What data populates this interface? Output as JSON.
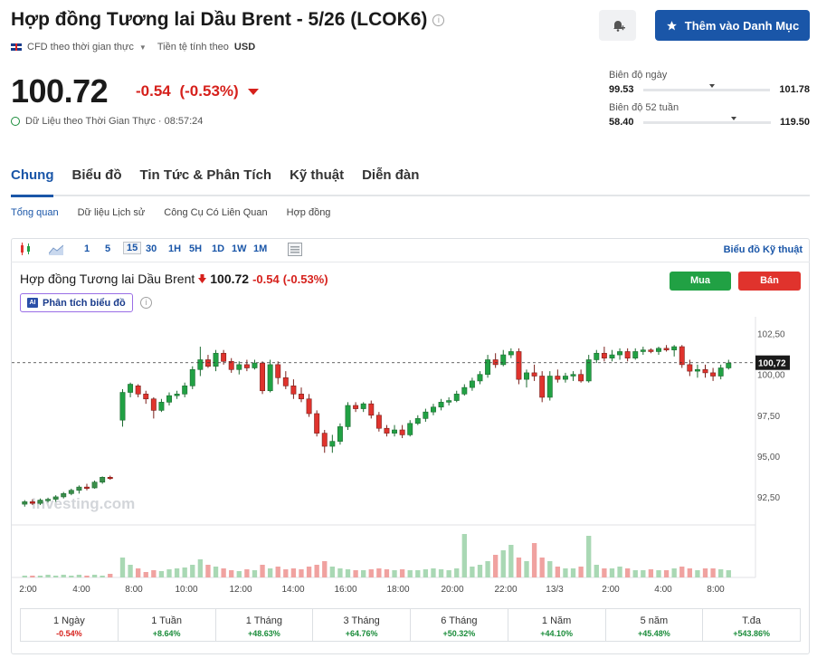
{
  "header": {
    "title": "Hợp đồng Tương lai Dầu Brent - 5/26 (LCOK6)",
    "info_glyph": "i",
    "watch_label": "Thêm vào Danh Mục",
    "cfd_label": "CFD theo thời gian thực",
    "currency_label": "Tiền tệ tính theo",
    "currency": "USD"
  },
  "quote": {
    "price": "100.72",
    "change": "-0.54",
    "change_pct": "(-0.53%)",
    "realtime_label": "Dữ Liệu theo Thời Gian Thực · 08:57:24"
  },
  "ranges": {
    "day": {
      "label": "Biên độ ngày",
      "low": "99.53",
      "high": "101.78",
      "position": 0.52
    },
    "week52": {
      "label": "Biên độ 52 tuần",
      "low": "58.40",
      "high": "119.50",
      "position": 0.69
    }
  },
  "main_tabs": [
    "Chung",
    "Biểu đồ",
    "Tin Tức & Phân Tích",
    "Kỹ thuật",
    "Diễn đàn"
  ],
  "sub_tabs": [
    "Tổng quan",
    "Dữ liệu Lịch sử",
    "Công Cụ Có Liên Quan",
    "Hợp đồng"
  ],
  "toolbar": {
    "intervals": [
      "1",
      "5",
      "15",
      "30",
      "1H",
      "5H",
      "1D",
      "1W",
      "1M"
    ],
    "selected_interval": "15",
    "advanced_label": "Biểu đồ Kỹ thuật"
  },
  "chart_header": {
    "name": "Hợp đồng Tương lai Dầu Brent",
    "price": "100.72",
    "change": "-0.54",
    "change_pct": "(-0.53%)",
    "buy_label": "Mua",
    "sell_label": "Bán",
    "ai_label": "Phân tích biểu đồ",
    "ai_badge": "AI",
    "watermark": "Investing.com"
  },
  "colors": {
    "up": "#21a144",
    "down": "#e0332d",
    "accent": "#1a56a8"
  },
  "chart_data": {
    "type": "candlestick",
    "y_ticks": [
      "102,50",
      "100,00",
      "97,50",
      "95,00",
      "92,50"
    ],
    "ylim": [
      91.0,
      103.2
    ],
    "current_label": "100,72",
    "current_value": 100.72,
    "x_ticks": [
      "2:00",
      "4:00",
      "8:00",
      "10:00",
      "12:00",
      "14:00",
      "16:00",
      "18:00",
      "20:00",
      "22:00",
      "13/3",
      "2:00",
      "4:00",
      "8:00"
    ],
    "candles": [
      [
        92.05,
        92.3,
        91.9,
        92.2
      ],
      [
        92.2,
        92.35,
        92.0,
        92.1
      ],
      [
        92.1,
        92.4,
        92.0,
        92.3
      ],
      [
        92.3,
        92.45,
        92.15,
        92.35
      ],
      [
        92.35,
        92.6,
        92.2,
        92.5
      ],
      [
        92.5,
        92.8,
        92.4,
        92.7
      ],
      [
        92.7,
        93.0,
        92.6,
        92.9
      ],
      [
        92.9,
        93.2,
        92.7,
        93.1
      ],
      [
        93.1,
        93.3,
        92.9,
        93.05
      ],
      [
        93.05,
        93.5,
        93.0,
        93.4
      ],
      [
        93.4,
        93.75,
        93.3,
        93.7
      ],
      [
        93.7,
        93.8,
        93.55,
        93.65
      ],
      [
        97.2,
        99.1,
        96.8,
        98.9
      ],
      [
        98.9,
        99.5,
        98.6,
        99.4
      ],
      [
        99.3,
        99.4,
        98.6,
        98.8
      ],
      [
        98.8,
        99.0,
        98.2,
        98.5
      ],
      [
        98.5,
        98.6,
        97.3,
        97.8
      ],
      [
        97.8,
        98.5,
        97.7,
        98.3
      ],
      [
        98.3,
        98.9,
        98.1,
        98.7
      ],
      [
        98.7,
        99.0,
        98.5,
        98.8
      ],
      [
        98.8,
        99.5,
        98.6,
        99.3
      ],
      [
        99.3,
        100.5,
        99.1,
        100.3
      ],
      [
        100.3,
        101.7,
        99.9,
        100.9
      ],
      [
        100.9,
        101.2,
        100.4,
        100.5
      ],
      [
        100.5,
        101.5,
        100.2,
        101.3
      ],
      [
        101.3,
        101.5,
        100.6,
        100.8
      ],
      [
        100.8,
        101.0,
        100.1,
        100.3
      ],
      [
        100.3,
        100.8,
        100.0,
        100.6
      ],
      [
        100.6,
        100.9,
        100.2,
        100.4
      ],
      [
        100.4,
        100.9,
        100.3,
        100.7
      ],
      [
        100.7,
        100.8,
        98.8,
        99.0
      ],
      [
        99.0,
        100.9,
        98.9,
        100.6
      ],
      [
        100.6,
        100.8,
        99.4,
        99.8
      ],
      [
        99.8,
        100.2,
        99.1,
        99.3
      ],
      [
        99.3,
        99.7,
        98.5,
        98.8
      ],
      [
        98.8,
        99.2,
        98.3,
        98.5
      ],
      [
        98.5,
        98.8,
        97.4,
        97.6
      ],
      [
        97.6,
        97.8,
        96.2,
        96.4
      ],
      [
        96.4,
        96.6,
        95.2,
        95.6
      ],
      [
        95.6,
        96.3,
        95.2,
        95.9
      ],
      [
        95.9,
        97.0,
        95.7,
        96.8
      ],
      [
        96.8,
        98.3,
        96.6,
        98.1
      ],
      [
        98.1,
        98.3,
        97.7,
        97.9
      ],
      [
        97.9,
        98.3,
        97.7,
        98.2
      ],
      [
        98.2,
        98.4,
        97.3,
        97.5
      ],
      [
        97.5,
        97.7,
        96.5,
        96.7
      ],
      [
        96.7,
        96.9,
        96.2,
        96.4
      ],
      [
        96.4,
        96.9,
        96.2,
        96.6
      ],
      [
        96.6,
        96.9,
        96.1,
        96.3
      ],
      [
        96.3,
        97.2,
        96.2,
        97.0
      ],
      [
        97.0,
        97.5,
        96.9,
        97.3
      ],
      [
        97.3,
        97.9,
        97.1,
        97.7
      ],
      [
        97.7,
        98.2,
        97.5,
        98.0
      ],
      [
        98.0,
        98.5,
        97.8,
        98.3
      ],
      [
        98.3,
        98.6,
        98.1,
        98.4
      ],
      [
        98.4,
        99.0,
        98.3,
        98.8
      ],
      [
        98.8,
        99.4,
        98.7,
        99.2
      ],
      [
        99.2,
        99.8,
        99.0,
        99.6
      ],
      [
        99.6,
        100.2,
        99.4,
        100.0
      ],
      [
        100.0,
        101.2,
        99.8,
        100.9
      ],
      [
        100.9,
        101.3,
        100.4,
        100.6
      ],
      [
        100.6,
        101.5,
        100.5,
        101.2
      ],
      [
        101.2,
        101.6,
        101.0,
        101.4
      ],
      [
        101.4,
        101.6,
        99.4,
        99.7
      ],
      [
        99.7,
        100.3,
        99.2,
        100.1
      ],
      [
        100.1,
        100.6,
        99.6,
        99.9
      ],
      [
        99.9,
        100.2,
        98.3,
        98.6
      ],
      [
        98.6,
        100.2,
        98.4,
        99.9
      ],
      [
        99.9,
        100.3,
        99.5,
        99.7
      ],
      [
        99.7,
        100.1,
        99.5,
        99.9
      ],
      [
        99.9,
        100.2,
        99.6,
        100.0
      ],
      [
        100.0,
        100.3,
        99.5,
        99.6
      ],
      [
        99.6,
        101.2,
        99.5,
        100.9
      ],
      [
        100.9,
        101.5,
        100.7,
        101.3
      ],
      [
        101.3,
        101.7,
        100.8,
        101.0
      ],
      [
        101.0,
        101.5,
        100.8,
        101.2
      ],
      [
        101.2,
        101.6,
        100.9,
        101.4
      ],
      [
        101.4,
        101.6,
        100.8,
        101.0
      ],
      [
        101.0,
        101.6,
        100.9,
        101.4
      ],
      [
        101.4,
        101.7,
        101.2,
        101.5
      ],
      [
        101.5,
        101.6,
        101.3,
        101.4
      ],
      [
        101.4,
        101.7,
        101.2,
        101.6
      ],
      [
        101.6,
        101.8,
        101.4,
        101.5
      ],
      [
        101.5,
        101.8,
        101.1,
        101.7
      ],
      [
        101.7,
        101.8,
        100.4,
        100.6
      ],
      [
        100.6,
        100.9,
        99.9,
        100.2
      ],
      [
        100.2,
        100.6,
        99.8,
        100.3
      ],
      [
        100.3,
        100.6,
        99.8,
        100.1
      ],
      [
        100.1,
        100.4,
        99.6,
        99.9
      ],
      [
        99.9,
        100.6,
        99.7,
        100.4
      ],
      [
        100.4,
        100.9,
        100.3,
        100.7
      ]
    ],
    "volumes": [
      2,
      2,
      2,
      3,
      2,
      3,
      2,
      3,
      2,
      3,
      2,
      4,
      22,
      14,
      10,
      6,
      8,
      7,
      9,
      10,
      11,
      14,
      20,
      14,
      12,
      10,
      8,
      7,
      9,
      8,
      14,
      10,
      12,
      9,
      10,
      9,
      12,
      14,
      18,
      12,
      10,
      9,
      8,
      8,
      9,
      10,
      9,
      8,
      9,
      8,
      8,
      9,
      10,
      9,
      8,
      10,
      48,
      12,
      14,
      18,
      25,
      30,
      36,
      22,
      18,
      38,
      22,
      18,
      12,
      10,
      10,
      12,
      46,
      14,
      10,
      10,
      12,
      10,
      8,
      8,
      9,
      8,
      8,
      10,
      12,
      10,
      8,
      10,
      10,
      9,
      8
    ],
    "volume_colors_up_index_based": true
  },
  "performance": [
    {
      "label": "1 Ngày",
      "value": "-0.54%",
      "dir": "down"
    },
    {
      "label": "1 Tuần",
      "value": "+8.64%",
      "dir": "up"
    },
    {
      "label": "1 Tháng",
      "value": "+48.63%",
      "dir": "up"
    },
    {
      "label": "3 Tháng",
      "value": "+64.76%",
      "dir": "up"
    },
    {
      "label": "6 Tháng",
      "value": "+50.32%",
      "dir": "up"
    },
    {
      "label": "1 Năm",
      "value": "+44.10%",
      "dir": "up"
    },
    {
      "label": "5 năm",
      "value": "+45.48%",
      "dir": "up"
    },
    {
      "label": "T.đa",
      "value": "+543.86%",
      "dir": "up"
    }
  ]
}
